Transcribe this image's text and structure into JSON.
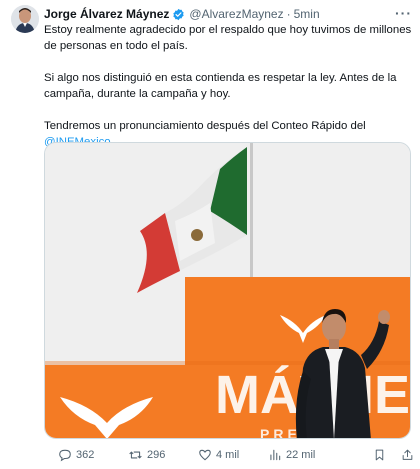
{
  "author": {
    "name": "Jorge Álvarez Máynez",
    "handle": "@AlvarezMaynez",
    "separator": "·",
    "time": "5min"
  },
  "tweet": {
    "paragraph1": "Estoy realmente agradecido por el respaldo que hoy tuvimos de millones de personas en todo el país.",
    "paragraph2": "Si algo nos distinguió en esta contienda es respetar la ley. Antes de la campaña, durante la campaña y hoy.",
    "paragraph3": "Tendremos un pronunciamiento después del Conteo Rápido del",
    "mention": "@INEMexico",
    "mention_suffix": "."
  },
  "media": {
    "banner_text": "MÁYNEZ",
    "banner_subtext": "PRES"
  },
  "actions": {
    "replies": "362",
    "reposts": "296",
    "likes": "4 mil",
    "views": "22 mil"
  },
  "colors": {
    "accent": "#1d9bf0",
    "orange": "#f47b24",
    "text": "#0f1419",
    "muted": "#536471"
  }
}
